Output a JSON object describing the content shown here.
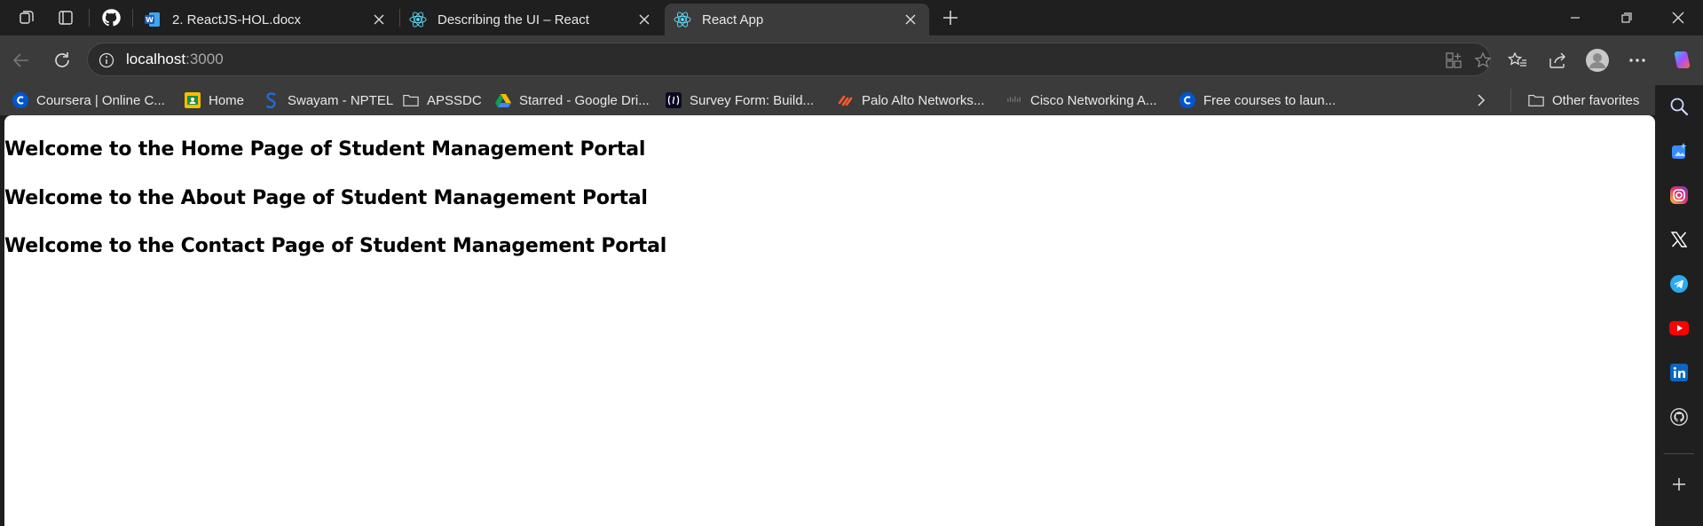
{
  "tabs": [
    {
      "title": "2. ReactJS-HOL.docx",
      "icon": "word-doc-icon"
    },
    {
      "title": "Describing the UI – React",
      "icon": "react-icon"
    },
    {
      "title": "React App",
      "icon": "react-icon",
      "active": true
    }
  ],
  "address": {
    "host": "localhost",
    "port": ":3000"
  },
  "favorites": [
    {
      "label": "Coursera | Online C...",
      "icon": "coursera-icon"
    },
    {
      "label": "Home",
      "icon": "classroom-icon"
    },
    {
      "label": "Swayam - NPTEL",
      "icon": "swayam-icon"
    },
    {
      "label": "APSSDC",
      "icon": "folder-icon"
    },
    {
      "label": "Starred - Google Dri...",
      "icon": "google-drive-icon"
    },
    {
      "label": "Survey Form: Build...",
      "icon": "freecodecamp-icon"
    },
    {
      "label": "Palo Alto Networks...",
      "icon": "palo-alto-icon"
    },
    {
      "label": "Cisco Networking A...",
      "icon": "cisco-icon"
    },
    {
      "label": "Free courses to laun...",
      "icon": "coursera-icon"
    }
  ],
  "other_favorites": "Other favorites",
  "page": {
    "headings": [
      "Welcome to the Home Page of Student Management Portal",
      "Welcome to the About Page of Student Management Portal",
      "Welcome to the Contact Page of Student Management Portal"
    ]
  },
  "colors": {
    "chrome_dark": "#1f1f1f",
    "chrome_mid": "#3b3b3b",
    "page_bg": "#ffffff",
    "react_blue": "#61dafb"
  }
}
